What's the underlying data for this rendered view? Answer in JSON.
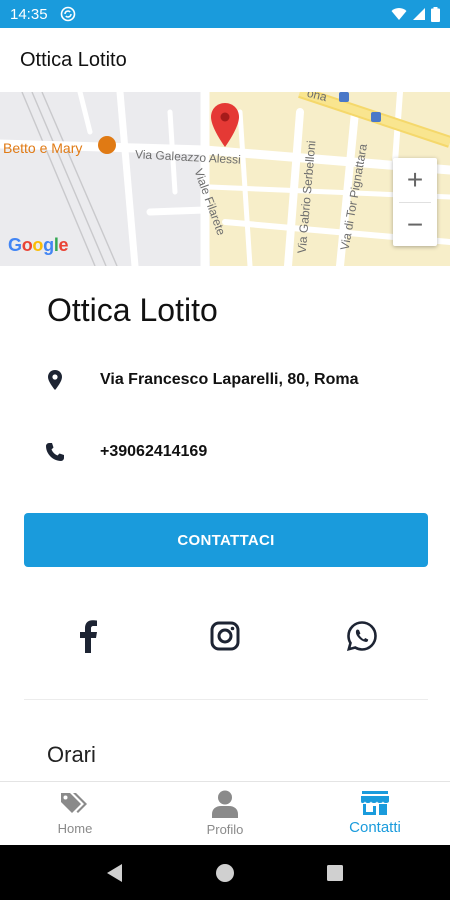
{
  "status_bar": {
    "time": "14:35",
    "icons": [
      "sync-icon",
      "wifi-icon",
      "signal-icon",
      "battery-icon"
    ],
    "background": "#1a9bdc"
  },
  "app_bar": {
    "title": "Ottica Lotito"
  },
  "map": {
    "streets": [
      "Via Galeazzo Alessi",
      "Viale Filarete",
      "Via Gabrio Serbelloni",
      "Via di Tor Pignattara"
    ],
    "partial_label": "ona",
    "poi": "Betto e Mary",
    "logo": "Google",
    "zoom_in": "+",
    "zoom_out": "−"
  },
  "shop": {
    "name": "Ottica Lotito",
    "address": "Via Francesco Laparelli, 80, Roma",
    "phone": "+39062414169"
  },
  "contact_button": {
    "label": "CONTATTACI"
  },
  "social": [
    "facebook-icon",
    "instagram-icon",
    "whatsapp-icon"
  ],
  "sections": {
    "hours_title": "Orari"
  },
  "bottom_nav": {
    "items": [
      {
        "label": "Home",
        "icon": "tag-icon",
        "active": false
      },
      {
        "label": "Profilo",
        "icon": "user-icon",
        "active": false
      },
      {
        "label": "Contatti",
        "icon": "store-icon",
        "active": true
      }
    ]
  },
  "colors": {
    "accent": "#1a9bdc",
    "map_pin": "#e53935",
    "poi": "#e07a14"
  }
}
